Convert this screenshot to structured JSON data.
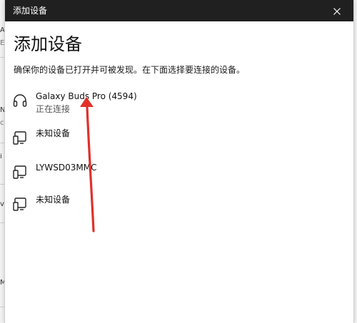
{
  "window": {
    "title": "添加设备"
  },
  "dialog": {
    "heading": "添加设备",
    "subtitle": "确保你的设备已打开并可被发现。在下面选择要连接的设备。"
  },
  "devices": [
    {
      "name": "Galaxy Buds Pro (4594)",
      "status": "正在连接",
      "icon": "headphones-icon"
    },
    {
      "name": "未知设备",
      "status": "",
      "icon": "device-icon"
    },
    {
      "name": "LYWSD03MMC",
      "status": "",
      "icon": "device-icon"
    },
    {
      "name": "未知设备",
      "status": "",
      "icon": "device-icon"
    }
  ],
  "background_fragments": [
    "A",
    "E",
    "N",
    "c",
    "i",
    "v",
    "M"
  ],
  "colors": {
    "titlebar": "#202020",
    "arrow": "#e0302a"
  }
}
